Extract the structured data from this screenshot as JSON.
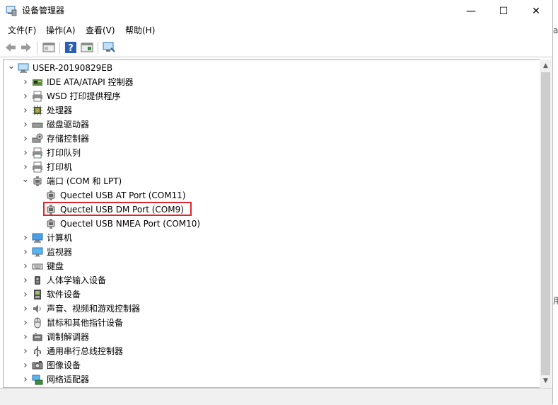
{
  "window": {
    "title": "设备管理器",
    "minimize_glyph": "—",
    "maximize_glyph": "☐",
    "close_glyph": "✕"
  },
  "menu": [
    "文件(F)",
    "操作(A)",
    "查看(V)",
    "帮助(H)"
  ],
  "tree": {
    "root": "USER-20190829EB",
    "categories": [
      {
        "label": "IDE ATA/ATAPI 控制器",
        "icon": "ide-controller-icon",
        "expanded": false
      },
      {
        "label": "WSD 打印提供程序",
        "icon": "printer-icon",
        "expanded": false
      },
      {
        "label": "处理器",
        "icon": "processor-icon",
        "expanded": false
      },
      {
        "label": "磁盘驱动器",
        "icon": "disk-drive-icon",
        "expanded": false
      },
      {
        "label": "存储控制器",
        "icon": "storage-controller-icon",
        "expanded": false
      },
      {
        "label": "打印队列",
        "icon": "print-queue-icon",
        "expanded": false
      },
      {
        "label": "打印机",
        "icon": "printer-icon",
        "expanded": false
      },
      {
        "label": "端口 (COM 和 LPT)",
        "icon": "port-icon",
        "expanded": true,
        "children": [
          {
            "label": "Quectel USB AT Port (COM11)",
            "icon": "port-icon"
          },
          {
            "label": "Quectel USB DM Port (COM9)",
            "icon": "port-icon",
            "highlighted": true
          },
          {
            "label": "Quectel USB NMEA Port (COM10)",
            "icon": "port-icon"
          }
        ]
      },
      {
        "label": "计算机",
        "icon": "computer-icon",
        "expanded": false
      },
      {
        "label": "监视器",
        "icon": "monitor-icon",
        "expanded": false
      },
      {
        "label": "键盘",
        "icon": "keyboard-icon",
        "expanded": false
      },
      {
        "label": "人体学输入设备",
        "icon": "hid-icon",
        "expanded": false
      },
      {
        "label": "软件设备",
        "icon": "software-device-icon",
        "expanded": false
      },
      {
        "label": "声音、视频和游戏控制器",
        "icon": "sound-icon",
        "expanded": false
      },
      {
        "label": "鼠标和其他指针设备",
        "icon": "mouse-icon",
        "expanded": false
      },
      {
        "label": "调制解调器",
        "icon": "modem-icon",
        "expanded": false
      },
      {
        "label": "通用串行总线控制器",
        "icon": "usb-icon",
        "expanded": false
      },
      {
        "label": "图像设备",
        "icon": "imaging-icon",
        "expanded": false
      },
      {
        "label": "网络适配器",
        "icon": "network-adapter-icon",
        "expanded": false
      }
    ]
  },
  "edge_fragments": {
    "top": "ar",
    "middle": "用"
  },
  "colors": {
    "highlight": "#e0262c",
    "accent": "#1e78c8"
  }
}
